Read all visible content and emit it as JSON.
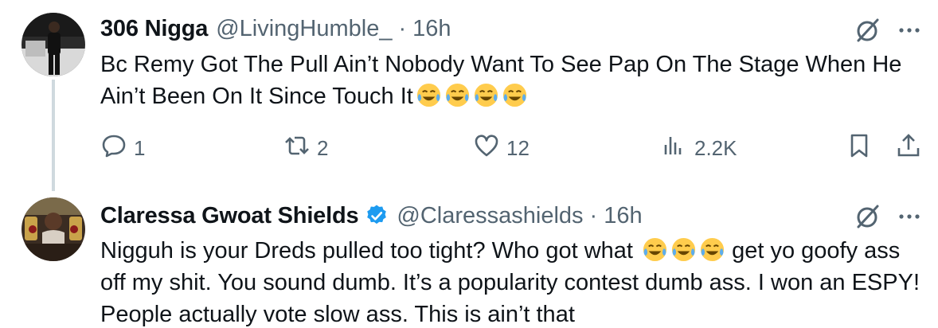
{
  "tweets": [
    {
      "display_name": "306 Nigga",
      "handle": "@LivingHumble_",
      "separator": "·",
      "time": "16h",
      "text": "Bc Remy Got The Pull Ain’t Nobody Want To See Pap On The Stage When He Ain’t Been On It Since Touch It",
      "emojis": [
        "😂",
        "😂",
        "😂",
        "😂"
      ],
      "reply_count": "1",
      "retweet_count": "2",
      "like_count": "12",
      "view_count": "2.2K",
      "verified": false
    },
    {
      "display_name": "Claressa Gwoat Shields",
      "handle": "@Claressashields",
      "separator": "·",
      "time": "16h",
      "text_part1": "Nigguh is your Dreds pulled too tight? Who got what",
      "emojis": [
        "😂",
        "😂",
        "😂"
      ],
      "text_part2": "get yo goofy ass off my shit. You sound dumb. It’s a popularity contest dumb ass. I won an ESPY! People actually vote slow ass. This is ain’t that",
      "verified": true
    }
  ],
  "icons": {
    "grok": "grok-icon",
    "more": "more-icon",
    "reply": "reply-icon",
    "retweet": "retweet-icon",
    "like": "like-icon",
    "views": "views-icon",
    "bookmark": "bookmark-icon",
    "share": "share-icon",
    "verified": "verified-badge-icon"
  },
  "colors": {
    "text": "#0f1419",
    "secondary": "#536471",
    "verified_blue": "#1d9bf0",
    "thread_line": "#cfd9de"
  }
}
